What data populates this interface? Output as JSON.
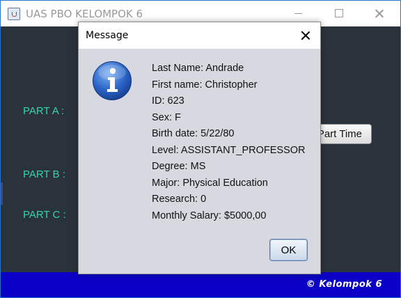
{
  "window": {
    "title": "UAS PBO KELOMPOK 6",
    "icon": "java-cup-icon"
  },
  "main": {
    "part_a": "PART A :",
    "part_b": "PART B :",
    "part_c": "PART C :",
    "part_time_button": "Part Time"
  },
  "footer": {
    "text": "© Kelompok 6",
    "color": "#0a00c6"
  },
  "dialog": {
    "title": "Message",
    "icon": "info-icon",
    "lines": [
      "Last Name: Andrade",
      "First name: Christopher",
      "ID: 623",
      "Sex: F",
      "Birth date: 5/22/80",
      "Level: ASSISTANT_PROFESSOR",
      "Degree: MS",
      "Major: Physical Education",
      "Research: 0",
      "Monthly Salary: $5000,00"
    ],
    "ok_label": "OK"
  },
  "colors": {
    "content_bg": "#2a333b",
    "label_color": "#33d6a8",
    "dialog_bg": "#d6d9df"
  }
}
